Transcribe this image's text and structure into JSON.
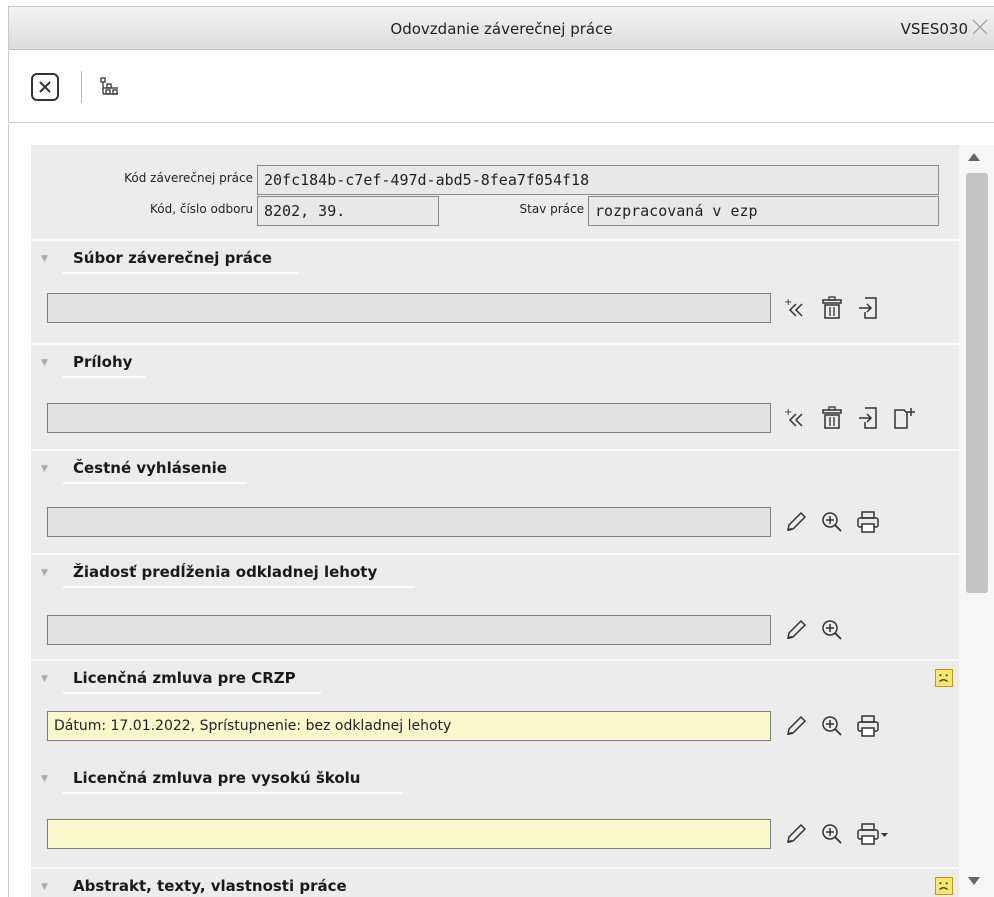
{
  "window": {
    "title": "Odovzdanie záverečnej práce",
    "code": "VSES030"
  },
  "header_fields": {
    "kod_label": "Kód záverečnej práce",
    "kod_value": "20fc184b-c7ef-497d-abd5-8fea7f054f18",
    "odbor_label": "Kód, číslo odboru",
    "odbor_value": "8202, 39.",
    "stav_label": "Stav práce",
    "stav_value": "rozpracovaná v ezp"
  },
  "sections": [
    {
      "title": "Súbor záverečnej práce",
      "value": "",
      "icons": [
        "add-icon",
        "delete-icon",
        "import-icon"
      ]
    },
    {
      "title": "Prílohy",
      "value": "",
      "icons": [
        "add-icon",
        "delete-icon",
        "import-icon",
        "new-document-icon"
      ]
    },
    {
      "title": "Čestné vyhlásenie",
      "value": "",
      "icons": [
        "edit-icon",
        "zoom-icon",
        "print-icon"
      ]
    },
    {
      "title": "Žiadosť predĺženia odkladnej lehoty",
      "value": "",
      "icons": [
        "edit-icon",
        "zoom-icon"
      ]
    },
    {
      "title": "Licenčná zmluva pre CRZP",
      "value": "Dátum: 17.01.2022, Sprístupnenie: bez odkladnej lehoty",
      "icons": [
        "edit-icon",
        "zoom-icon",
        "print-icon"
      ],
      "status": "sad-face-icon"
    },
    {
      "title": "Licenčná zmluva pre vysokú školu",
      "value": "",
      "icons": [
        "edit-icon",
        "zoom-icon",
        "print-dropdown-icon"
      ]
    },
    {
      "title": "Abstrakt, texty, vlastnosti práce",
      "status": "sad-face-icon"
    }
  ],
  "colors": {
    "panel": "#ececec",
    "yellow_field": "#fbf8cc",
    "status_yellow": "#f6e96a"
  }
}
